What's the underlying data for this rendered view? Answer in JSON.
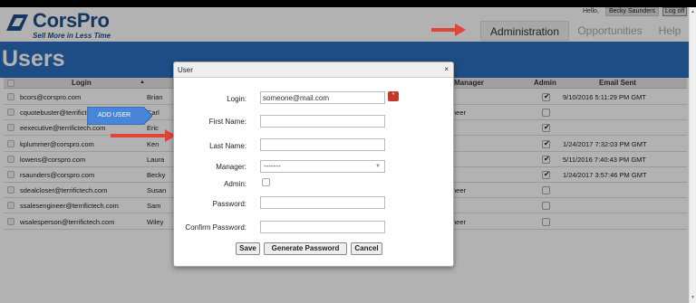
{
  "header": {
    "logo_name": "CorsPro",
    "logo_tagline": "Sell More in Less Time",
    "greeting": "Hello,",
    "user_name": "Becky Saunders",
    "logoff_label": "Log off"
  },
  "nav": {
    "tabs": [
      "Administration",
      "Opportunities",
      "Help"
    ]
  },
  "page_title": "Users",
  "add_user_label": "ADD USER",
  "grid": {
    "columns": {
      "login": "Login",
      "manager": "Manager",
      "admin": "Admin",
      "email_sent": "Email Sent"
    },
    "rows": [
      {
        "login": "bcors@corspro.com",
        "first": "Brian",
        "manager": "",
        "admin": true,
        "email_sent": "9/10/2016 5:11:29 PM GMT"
      },
      {
        "login": "cquotebuster@terrifictech.com",
        "first": "Carl",
        "manager": "neer",
        "admin": false,
        "email_sent": ""
      },
      {
        "login": "eexecutive@terrifictech.com",
        "first": "Eric",
        "manager": "",
        "admin": true,
        "email_sent": ""
      },
      {
        "login": "kplummer@corspro.com",
        "first": "Ken",
        "manager": "",
        "admin": true,
        "email_sent": "1/24/2017 7:32:03 PM GMT"
      },
      {
        "login": "lowens@corspro.com",
        "first": "Laura",
        "manager": "",
        "admin": true,
        "email_sent": "5/11/2016 7:40:43 PM GMT"
      },
      {
        "login": "rsaunders@corspro.com",
        "first": "Becky",
        "manager": "",
        "admin": true,
        "email_sent": "1/24/2017 3:57:46 PM GMT"
      },
      {
        "login": "sdealcloser@terrifictech.com",
        "first": "Susan",
        "manager": "neer",
        "admin": false,
        "email_sent": ""
      },
      {
        "login": "ssalesengineer@terrifictech.com",
        "first": "Sam",
        "manager": "",
        "admin": false,
        "email_sent": ""
      },
      {
        "login": "wsalesperson@terrifictech.com",
        "first": "Wiley",
        "manager": "neer",
        "admin": false,
        "email_sent": ""
      }
    ]
  },
  "dialog": {
    "title": "User",
    "close": "×",
    "labels": {
      "login": "Login:",
      "first_name": "First Name:",
      "last_name": "Last Name:",
      "manager": "Manager:",
      "admin": "Admin:",
      "password": "Password:",
      "confirm_password": "Confirm Password:"
    },
    "values": {
      "login": "someone@mail.com",
      "first_name": "",
      "last_name": "",
      "manager": "-------",
      "password": "",
      "confirm_password": ""
    },
    "required_marker": "*",
    "buttons": {
      "save": "Save",
      "generate": "Generate Password",
      "cancel": "Cancel"
    }
  },
  "colors": {
    "band": "#2a6fbd",
    "brand": "#1d4f8c",
    "arrow": "#e0453c",
    "add_user": "#4a86d8"
  }
}
